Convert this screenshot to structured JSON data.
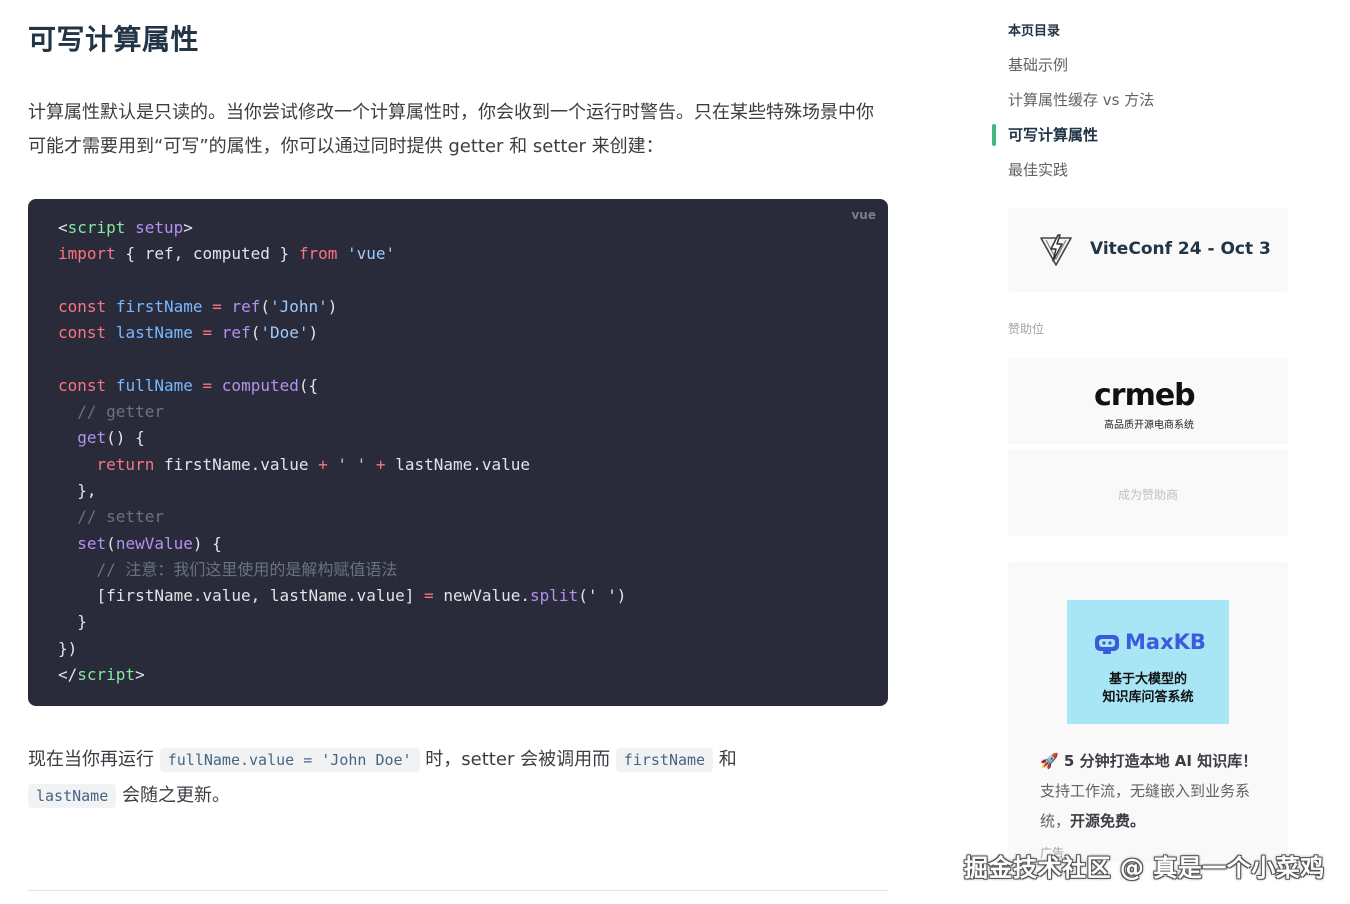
{
  "page": {
    "title": "可写计算属性",
    "intro": "计算属性默认是只读的。当你尝试修改一个计算属性时，你会收到一个运行时警告。只在某些特殊场景中你可能才需要用到“可写”的属性，你可以通过同时提供 getter 和 setter 来创建："
  },
  "code": {
    "lang": "vue",
    "lines": [
      [
        [
          "tk-pl",
          "<"
        ],
        [
          "tk-tag",
          "script"
        ],
        [
          "tk-pl",
          " "
        ],
        [
          "tk-attr",
          "setup"
        ],
        [
          "tk-pl",
          ">"
        ]
      ],
      [
        [
          "tk-kw",
          "import"
        ],
        [
          "tk-pl",
          " { ref, computed } "
        ],
        [
          "tk-kw",
          "from"
        ],
        [
          "tk-pl",
          " "
        ],
        [
          "tk-str",
          "'vue'"
        ]
      ],
      [],
      [
        [
          "tk-kw",
          "const"
        ],
        [
          "tk-pl",
          " "
        ],
        [
          "tk-var",
          "firstName"
        ],
        [
          "tk-pl",
          " "
        ],
        [
          "tk-op",
          "="
        ],
        [
          "tk-pl",
          " "
        ],
        [
          "tk-fn",
          "ref"
        ],
        [
          "tk-pl",
          "("
        ],
        [
          "tk-str",
          "'John'"
        ],
        [
          "tk-pl",
          ")"
        ]
      ],
      [
        [
          "tk-kw",
          "const"
        ],
        [
          "tk-pl",
          " "
        ],
        [
          "tk-var",
          "lastName"
        ],
        [
          "tk-pl",
          " "
        ],
        [
          "tk-op",
          "="
        ],
        [
          "tk-pl",
          " "
        ],
        [
          "tk-fn",
          "ref"
        ],
        [
          "tk-pl",
          "("
        ],
        [
          "tk-str",
          "'Doe'"
        ],
        [
          "tk-pl",
          ")"
        ]
      ],
      [],
      [
        [
          "tk-kw",
          "const"
        ],
        [
          "tk-pl",
          " "
        ],
        [
          "tk-var",
          "fullName"
        ],
        [
          "tk-pl",
          " "
        ],
        [
          "tk-op",
          "="
        ],
        [
          "tk-pl",
          " "
        ],
        [
          "tk-fn",
          "computed"
        ],
        [
          "tk-pl",
          "({"
        ]
      ],
      [
        [
          "tk-cm",
          "  // getter"
        ]
      ],
      [
        [
          "tk-pl",
          "  "
        ],
        [
          "tk-fn",
          "get"
        ],
        [
          "tk-pl",
          "() {"
        ]
      ],
      [
        [
          "tk-pl",
          "    "
        ],
        [
          "tk-kw",
          "return"
        ],
        [
          "tk-pl",
          " firstName.value "
        ],
        [
          "tk-op",
          "+"
        ],
        [
          "tk-pl",
          " "
        ],
        [
          "tk-str",
          "' '"
        ],
        [
          "tk-pl",
          " "
        ],
        [
          "tk-op",
          "+"
        ],
        [
          "tk-pl",
          " lastName.value"
        ]
      ],
      [
        [
          "tk-pl",
          "  },"
        ]
      ],
      [
        [
          "tk-cm",
          "  // setter"
        ]
      ],
      [
        [
          "tk-pl",
          "  "
        ],
        [
          "tk-fn",
          "set"
        ],
        [
          "tk-pl",
          "("
        ],
        [
          "tk-attr",
          "newValue"
        ],
        [
          "tk-pl",
          ") {"
        ]
      ],
      [
        [
          "tk-cm",
          "    // 注意：我们这里使用的是解构赋值语法"
        ]
      ],
      [
        [
          "tk-pl",
          "    [firstName.value, lastName.value] "
        ],
        [
          "tk-op",
          "="
        ],
        [
          "tk-pl",
          " newValue."
        ],
        [
          "tk-fn",
          "split"
        ],
        [
          "tk-pl",
          "(' ')"
        ]
      ],
      [
        [
          "tk-pl",
          "  }"
        ]
      ],
      [
        [
          "tk-pl",
          "})"
        ]
      ],
      [
        [
          "tk-pl",
          "</"
        ],
        [
          "tk-tag",
          "script"
        ],
        [
          "tk-pl",
          ">"
        ]
      ]
    ]
  },
  "after": {
    "t1": "现在当你再运行 ",
    "c1": "fullName.value = 'John Doe'",
    "t2": " 时，setter 会被调用而 ",
    "c2": "firstName",
    "t3": " 和 ",
    "c3": "lastName",
    "t4": " 会随之更新。"
  },
  "toc": {
    "title": "本页目录",
    "items": [
      {
        "label": "基础示例",
        "active": false
      },
      {
        "label": "计算属性缓存 vs 方法",
        "active": false
      },
      {
        "label": "可写计算属性",
        "active": true
      },
      {
        "label": "最佳实践",
        "active": false
      }
    ],
    "accent": "#42b883"
  },
  "viteconf": {
    "text": "ViteConf 24 - Oct 3"
  },
  "sponsors": {
    "label": "赞助位",
    "crmeb_word": "crmeb",
    "crmeb_sub": "高品质开源电商系统",
    "become": "成为赞助商"
  },
  "ad": {
    "brand": "MaxKB",
    "tagline1": "基于大模型的",
    "tagline2": "知识库问答系统",
    "emoji": "🚀",
    "p1": " 5 分钟打造本地 AI 知识库！",
    "p2": "支持工作流，无缝嵌入到业务系统，",
    "p3": "开源免费。",
    "label": "广告"
  },
  "watermark": "掘金技术社区 @ 真是一个小菜鸡"
}
